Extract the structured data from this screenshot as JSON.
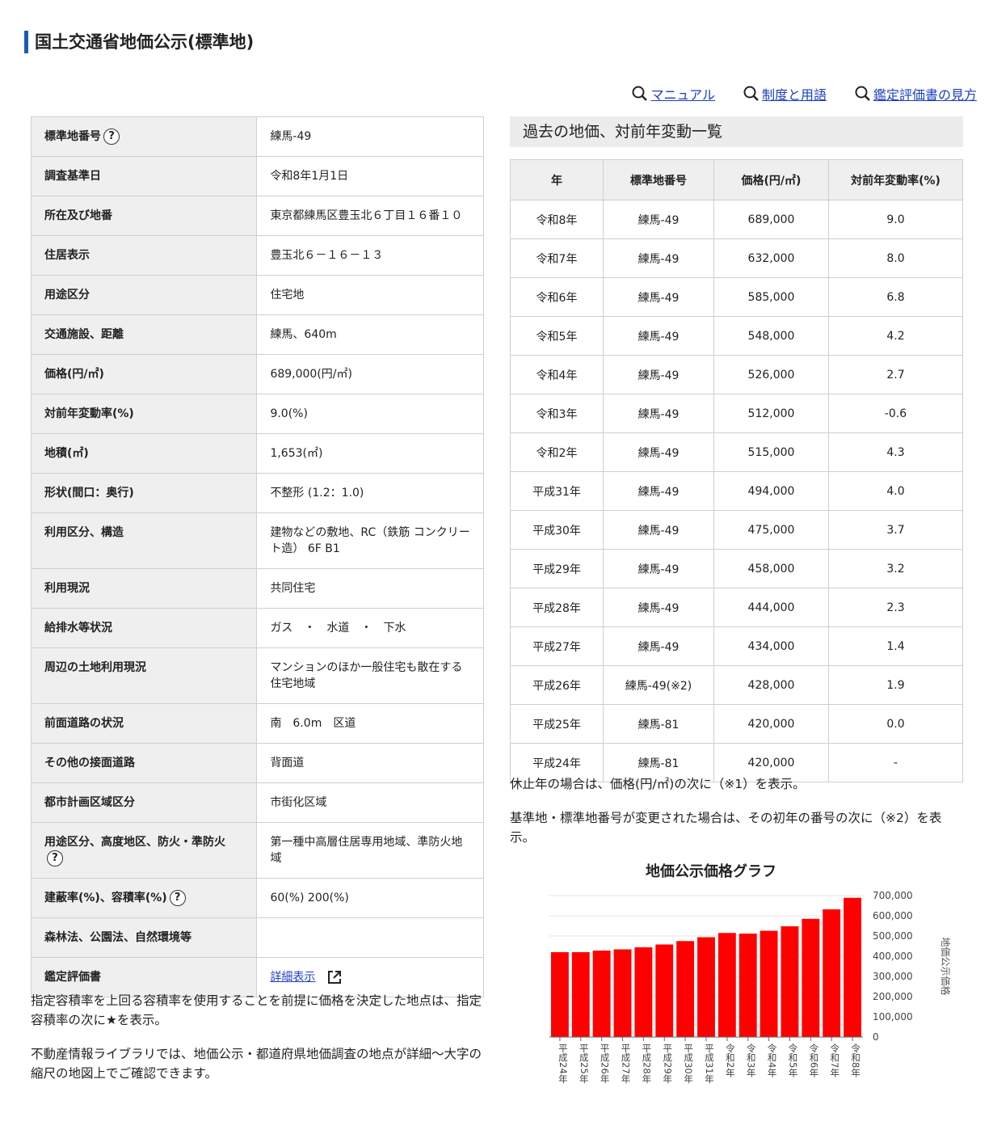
{
  "page_title": "国土交通省地価公示(標準地)",
  "links": [
    {
      "label": "マニュアル"
    },
    {
      "label": "制度と用語"
    },
    {
      "label": "鑑定評価書の見方"
    }
  ],
  "detail": {
    "rows": [
      {
        "label": "標準地番号",
        "value": "練馬-49",
        "help": "?"
      },
      {
        "label": "調査基準日",
        "value": "令和8年1月1日"
      },
      {
        "label": "所在及び地番",
        "value": "東京都練馬区豊玉北６丁目１６番１０"
      },
      {
        "label": "住居表示",
        "value": "豊玉北６－１６－１３"
      },
      {
        "label": "用途区分",
        "value": "住宅地"
      },
      {
        "label": "交通施設、距離",
        "value": "練馬、640m"
      },
      {
        "label": "価格(円/㎡)",
        "value": "689,000(円/㎡)"
      },
      {
        "label": "対前年変動率(%)",
        "value": "9.0(%)"
      },
      {
        "label": "地積(㎡)",
        "value": "1,653(㎡)"
      },
      {
        "label": "形状(間口：奥行)",
        "value": "不整形 (1.2：1.0)"
      },
      {
        "label": "利用区分、構造",
        "value": "建物などの敷地、RC（鉄筋 コンクリート造） 6F B1"
      },
      {
        "label": "利用現況",
        "value": "共同住宅"
      },
      {
        "label": "給排水等状況",
        "value": "ガス　・　水道　・　下水"
      },
      {
        "label": "周辺の土地利用現況",
        "value": "マンションのほか一般住宅も散在する住宅地域"
      },
      {
        "label": "前面道路の状況",
        "value": "南　6.0m　区道"
      },
      {
        "label": "その他の接面道路",
        "value": "背面道"
      },
      {
        "label": "都市計画区域区分",
        "value": "市街化区域"
      },
      {
        "label": "用途区分、高度地区、防火・準防火",
        "value": "第一種中高層住居専用地域、準防火地域",
        "help": "?"
      },
      {
        "label": "建蔽率(%)、容積率(%)",
        "value": "60(%) 200(%)",
        "help": "?"
      },
      {
        "label": "森林法、公園法、自然環境等",
        "value": ""
      },
      {
        "label": "鑑定評価書",
        "value": "詳細表示",
        "link": true
      }
    ]
  },
  "notes_left": [
    "指定容積率を上回る容積率を使用することを前提に価格を決定した地点は、指定容積率の次に★を表示。",
    "不動産情報ライブラリでは、地価公示・都道府県地価調査の地点が詳細～大字の縮尺の地図上でご確認できます。"
  ],
  "history": {
    "title": "過去の地価、対前年変動一覧",
    "columns": [
      "年",
      "標準地番号",
      "価格(円/㎡)",
      "対前年変動率(%)"
    ],
    "rows": [
      [
        "令和8年",
        "練馬-49",
        "689,000",
        "9.0"
      ],
      [
        "令和7年",
        "練馬-49",
        "632,000",
        "8.0"
      ],
      [
        "令和6年",
        "練馬-49",
        "585,000",
        "6.8"
      ],
      [
        "令和5年",
        "練馬-49",
        "548,000",
        "4.2"
      ],
      [
        "令和4年",
        "練馬-49",
        "526,000",
        "2.7"
      ],
      [
        "令和3年",
        "練馬-49",
        "512,000",
        "-0.6"
      ],
      [
        "令和2年",
        "練馬-49",
        "515,000",
        "4.3"
      ],
      [
        "平成31年",
        "練馬-49",
        "494,000",
        "4.0"
      ],
      [
        "平成30年",
        "練馬-49",
        "475,000",
        "3.7"
      ],
      [
        "平成29年",
        "練馬-49",
        "458,000",
        "3.2"
      ],
      [
        "平成28年",
        "練馬-49",
        "444,000",
        "2.3"
      ],
      [
        "平成27年",
        "練馬-49",
        "434,000",
        "1.4"
      ],
      [
        "平成26年",
        "練馬-49(※2)",
        "428,000",
        "1.9"
      ],
      [
        "平成25年",
        "練馬-81",
        "420,000",
        "0.0"
      ],
      [
        "平成24年",
        "練馬-81",
        "420,000",
        "-"
      ]
    ]
  },
  "notes_right": [
    "休止年の場合は、価格(円/㎡)の次に（※1）を表示。",
    "基準地・標準地番号が変更された場合は、その初年の番号の次に（※2）を表示。"
  ],
  "chart_data": {
    "type": "bar",
    "title": "地価公示価格グラフ",
    "ylabel": "地価公示価格",
    "categories": [
      "平成24年",
      "平成25年",
      "平成26年",
      "平成27年",
      "平成28年",
      "平成29年",
      "平成30年",
      "平成31年",
      "令和2年",
      "令和3年",
      "令和4年",
      "令和5年",
      "令和6年",
      "令和7年",
      "令和8年"
    ],
    "values": [
      420000,
      420000,
      428000,
      434000,
      444000,
      458000,
      475000,
      494000,
      515000,
      512000,
      526000,
      548000,
      585000,
      632000,
      689000
    ],
    "ylim": [
      0,
      700000
    ],
    "yticks": [
      "0",
      "100,000",
      "200,000",
      "300,000",
      "400,000",
      "500,000",
      "600,000",
      "700,000"
    ],
    "bar_color": "#ff0000",
    "grid": true
  }
}
